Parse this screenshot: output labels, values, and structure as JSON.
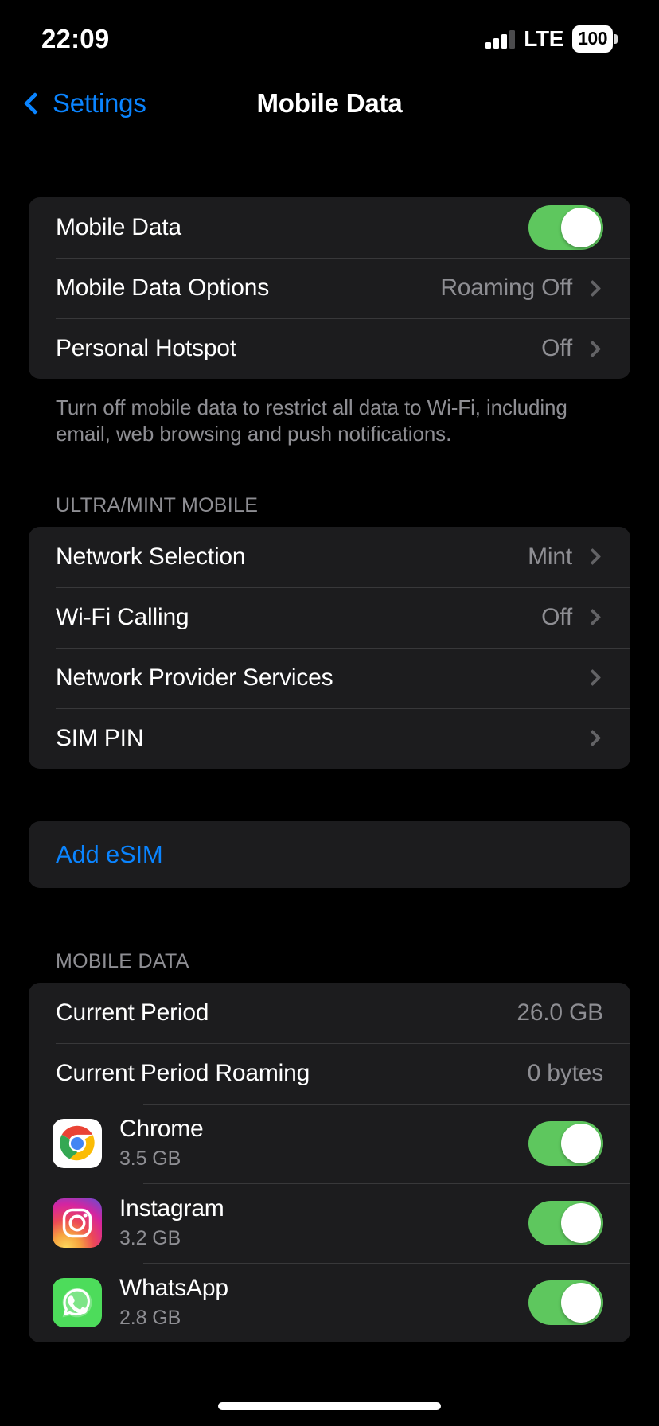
{
  "status_bar": {
    "time": "22:09",
    "network": "LTE",
    "battery": "100",
    "signal_icon": "cellular-bars-icon"
  },
  "nav": {
    "back_label": "Settings",
    "title": "Mobile Data"
  },
  "section_data": {
    "rows": [
      {
        "title": "Mobile Data",
        "accessory": "toggle",
        "value_on": true
      },
      {
        "title": "Mobile Data Options",
        "value": "Roaming Off",
        "accessory": "chevron"
      },
      {
        "title": "Personal Hotspot",
        "value": "Off",
        "accessory": "chevron"
      }
    ],
    "footer": "Turn off mobile data to restrict all data to Wi-Fi, including email, web browsing and push notifications."
  },
  "section_carrier": {
    "header": "ULTRA/MINT MOBILE",
    "rows": [
      {
        "title": "Network Selection",
        "value": "Mint",
        "accessory": "chevron"
      },
      {
        "title": "Wi-Fi Calling",
        "value": "Off",
        "accessory": "chevron"
      },
      {
        "title": "Network Provider Services",
        "value": "",
        "accessory": "chevron"
      },
      {
        "title": "SIM PIN",
        "value": "",
        "accessory": "chevron"
      }
    ]
  },
  "section_esim": {
    "add_label": "Add eSIM"
  },
  "section_usage": {
    "header": "MOBILE DATA",
    "rows": [
      {
        "title": "Current Period",
        "value": "26.0 GB"
      },
      {
        "title": "Current Period Roaming",
        "value": "0 bytes"
      }
    ],
    "apps": [
      {
        "name": "Chrome",
        "size": "3.5 GB",
        "icon": "chrome-icon",
        "enabled": true
      },
      {
        "name": "Instagram",
        "size": "3.2 GB",
        "icon": "instagram-icon",
        "enabled": true
      },
      {
        "name": "WhatsApp",
        "size": "2.8 GB",
        "icon": "whatsapp-icon",
        "enabled": true
      }
    ]
  },
  "colors": {
    "accent_blue": "#0a84ff",
    "toggle_green": "#5ec75e",
    "card_bg": "#1c1c1e",
    "secondary_text": "#8e8e93",
    "page_bg": "#000000"
  }
}
